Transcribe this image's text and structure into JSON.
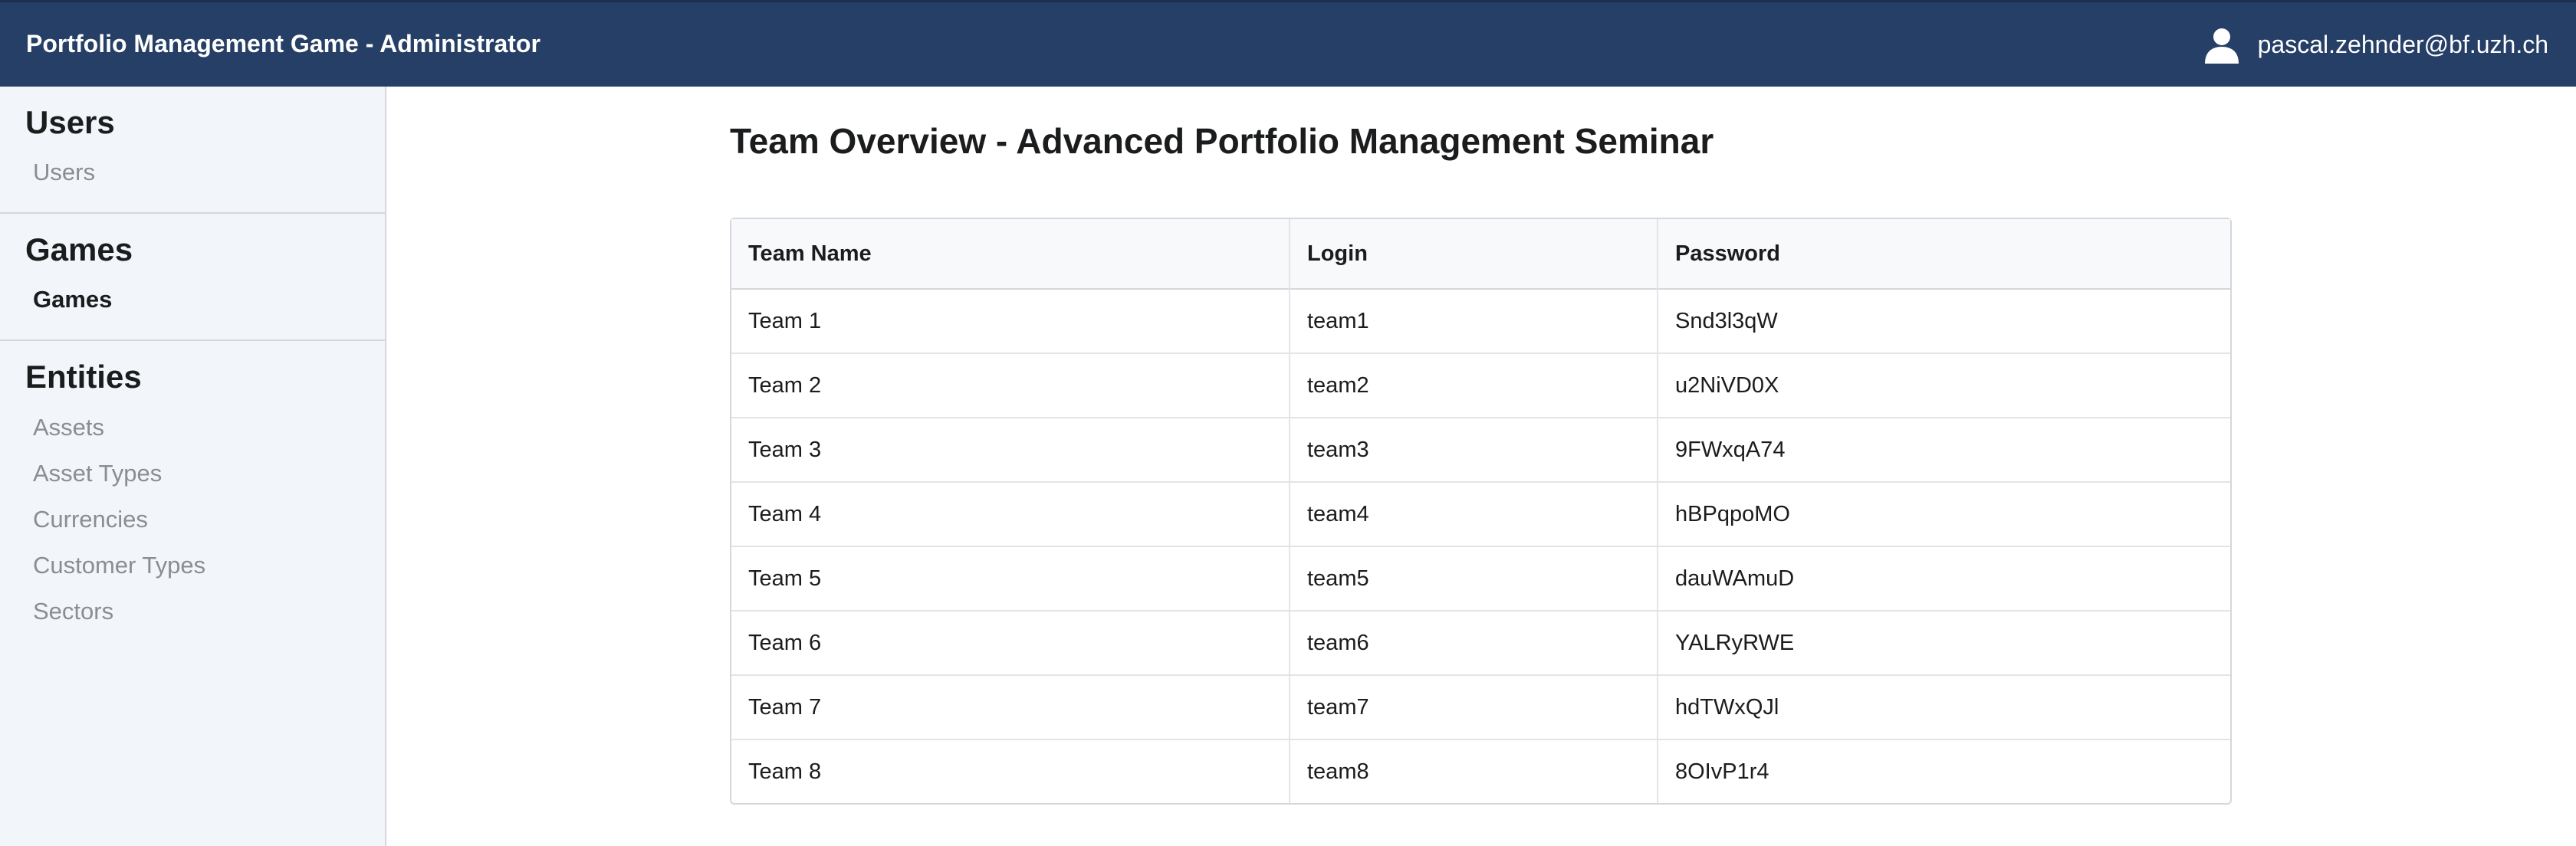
{
  "header": {
    "app_title": "Portfolio Management Game - Administrator",
    "user_icon": "user-icon",
    "user_email": "pascal.zehnder@bf.uzh.ch",
    "background_color": "#263f66"
  },
  "sidebar": {
    "sections": [
      {
        "heading": "Users",
        "items": [
          {
            "label": "Users",
            "active": false
          }
        ]
      },
      {
        "heading": "Games",
        "items": [
          {
            "label": "Games",
            "active": true
          }
        ]
      },
      {
        "heading": "Entities",
        "items": [
          {
            "label": "Assets",
            "active": false
          },
          {
            "label": "Asset Types",
            "active": false
          },
          {
            "label": "Currencies",
            "active": false
          },
          {
            "label": "Customer Types",
            "active": false
          },
          {
            "label": "Sectors",
            "active": false
          }
        ]
      }
    ]
  },
  "main": {
    "title": "Team Overview - Advanced Portfolio Management Seminar",
    "table": {
      "columns": [
        "Team Name",
        "Login",
        "Password"
      ],
      "rows": [
        [
          "Team 1",
          "team1",
          "Snd3l3qW"
        ],
        [
          "Team 2",
          "team2",
          "u2NiVD0X"
        ],
        [
          "Team 3",
          "team3",
          "9FWxqA74"
        ],
        [
          "Team 4",
          "team4",
          "hBPqpoMO"
        ],
        [
          "Team 5",
          "team5",
          "dauWAmuD"
        ],
        [
          "Team 6",
          "team6",
          "YALRyRWE"
        ],
        [
          "Team 7",
          "team7",
          "hdTWxQJl"
        ],
        [
          "Team 8",
          "team8",
          "8OIvP1r4"
        ]
      ]
    }
  }
}
